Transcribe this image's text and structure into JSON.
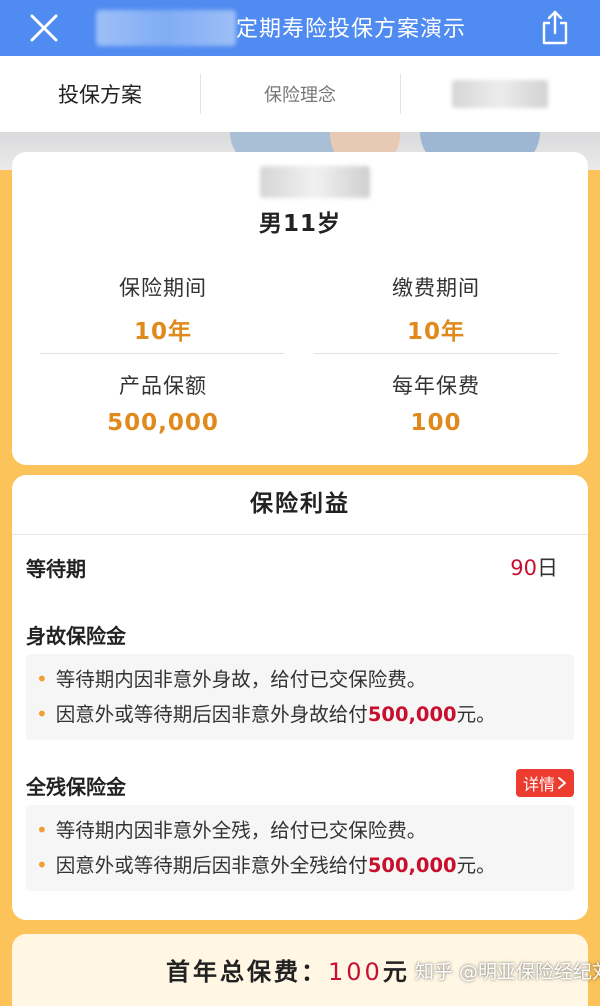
{
  "header": {
    "title": "定期寿险投保方案演示",
    "close_icon": "close-icon",
    "share_icon": "share-icon",
    "bg_color": "#4f8bf0"
  },
  "tabs": [
    {
      "label": "投保方案",
      "active": true
    },
    {
      "label": "保险理念",
      "active": false
    },
    {
      "label": "",
      "active": false
    }
  ],
  "summary": {
    "insured": "男11岁",
    "insurance_period_label": "保险期间",
    "insurance_period_value": "10年",
    "payment_period_label": "缴费期间",
    "payment_period_value": "10年",
    "sum_assured_label": "产品保额",
    "sum_assured_value": "500,000",
    "annual_premium_label": "每年保费",
    "annual_premium_value": "100",
    "accent_color": "#e0891c"
  },
  "benefits": {
    "title": "保险利益",
    "waiting_label": "等待期",
    "waiting_number": "90",
    "waiting_unit": "日",
    "death": {
      "title": "身故保险金",
      "line1": "等待期内因非意外身故，给付已交保险费。",
      "line2_prefix": "因意外或等待期后因非意外身故给付",
      "line2_amount": "500,000",
      "line2_suffix": "元。"
    },
    "disability": {
      "title": "全残保险金",
      "details_label": "详情",
      "line1": "等待期内因非意外全残，给付已交保险费。",
      "line2_prefix": "因意外或等待期后因非意外全残给付",
      "line2_amount": "500,000",
      "line2_suffix": "元。"
    }
  },
  "total": {
    "label": "首年总保费：",
    "amount": "100",
    "unit": "元"
  },
  "watermark": "知乎 @明亚保险经纪刘刚",
  "colors": {
    "page_bg": "#fcc35a",
    "amount_red": "#c8102e",
    "details_red": "#ee3b2f"
  }
}
